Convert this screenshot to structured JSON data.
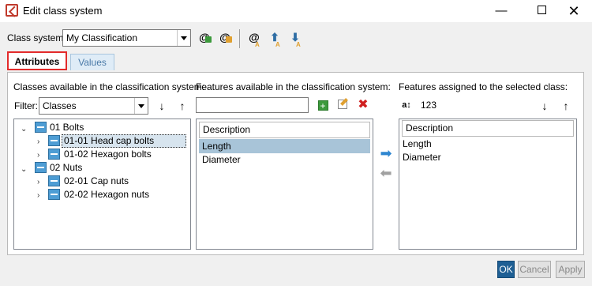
{
  "window": {
    "title": "Edit class system",
    "minimize": "—",
    "close": "✕"
  },
  "class_system": {
    "label": "Class system:",
    "value": "My Classification"
  },
  "tabs": [
    {
      "label": "Attributes"
    },
    {
      "label": "Values"
    }
  ],
  "left": {
    "header": "Classes available in the classification system:",
    "filter_label": "Filter:",
    "filter_value": "Classes",
    "tree": [
      {
        "label": "01 Bolts"
      },
      {
        "label": "01-01 Head cap bolts"
      },
      {
        "label": "01-02 Hexagon bolts"
      },
      {
        "label": "02 Nuts"
      },
      {
        "label": "02-01 Cap nuts"
      },
      {
        "label": "02-02 Hexagon nuts"
      }
    ]
  },
  "middle": {
    "header": "Features available in the classification system:",
    "search_value": "",
    "column": "Description",
    "rows": [
      "Length",
      "Diameter"
    ]
  },
  "right": {
    "header": "Features assigned to the selected class:",
    "sort_label": "123",
    "column": "Description",
    "rows": [
      "Length",
      "Diameter"
    ]
  },
  "buttons": {
    "ok": "OK",
    "cancel": "Cancel",
    "apply": "Apply"
  },
  "colors": {
    "accent": "#1e5f94",
    "selection": "#a8c4d8",
    "tab_highlight": "#e32b2b"
  }
}
